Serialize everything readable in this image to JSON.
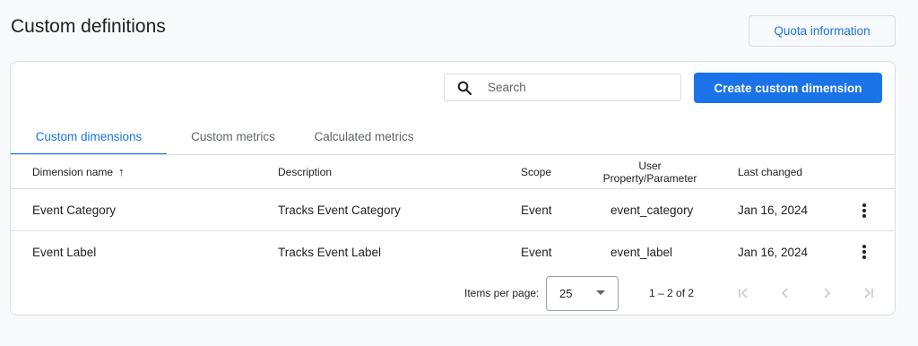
{
  "page": {
    "title": "Custom definitions",
    "quota_label": "Quota information"
  },
  "toolbar": {
    "search_placeholder": "Search",
    "create_label": "Create custom dimension"
  },
  "tabs": [
    {
      "label": "Custom dimensions",
      "active": true
    },
    {
      "label": "Custom metrics",
      "active": false
    },
    {
      "label": "Calculated metrics",
      "active": false
    }
  ],
  "table": {
    "columns": {
      "name": "Dimension name",
      "description": "Description",
      "scope": "Scope",
      "user_line1": "User",
      "user_line2": "Property/Parameter",
      "last_changed": "Last changed"
    },
    "sort_indicator": "↑",
    "rows": [
      {
        "name": "Event Category",
        "description": "Tracks Event Category",
        "scope": "Event",
        "param": "event_category",
        "last_changed": "Jan 16, 2024"
      },
      {
        "name": "Event Label",
        "description": "Tracks Event Label",
        "scope": "Event",
        "param": "event_label",
        "last_changed": "Jan 16, 2024"
      }
    ]
  },
  "pagination": {
    "items_per_page_label": "Items per page:",
    "items_per_page_value": "25",
    "range": "1 – 2 of 2"
  },
  "colors": {
    "accent": "#1a73e8",
    "border": "#dadce0",
    "text": "#202124",
    "muted": "#5f6368",
    "disabled": "#c4c7c5"
  }
}
